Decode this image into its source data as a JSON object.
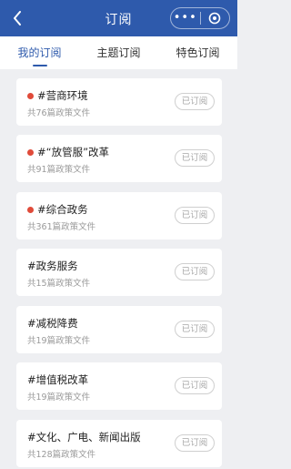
{
  "header": {
    "title": "订阅",
    "more_label": "•••"
  },
  "tabs": [
    {
      "label": "我的订阅",
      "active": true
    },
    {
      "label": "主题订阅",
      "active": false
    },
    {
      "label": "特色订阅",
      "active": false
    }
  ],
  "cards": [
    {
      "name": "#营商环境",
      "count": "共76篇政策文件",
      "dot": true,
      "button": "已订阅"
    },
    {
      "name": "#“放管服”改革",
      "count": "共91篇政策文件",
      "dot": true,
      "button": "已订阅"
    },
    {
      "name": "#综合政务",
      "count": "共361篇政策文件",
      "dot": true,
      "button": "已订阅"
    },
    {
      "name": "#政务服务",
      "count": "共15篇政策文件",
      "dot": false,
      "button": "已订阅"
    },
    {
      "name": "#减税降费",
      "count": "共19篇政策文件",
      "dot": false,
      "button": "已订阅"
    },
    {
      "name": "#增值税改革",
      "count": "共19篇政策文件",
      "dot": false,
      "button": "已订阅"
    },
    {
      "name": "#文化、广电、新闻出版",
      "count": "共128篇政策文件",
      "dot": false,
      "button": "已订阅"
    }
  ],
  "colors": {
    "accent": "#2e5aac",
    "dot": "#e04b3a",
    "background": "#eeeff2"
  }
}
